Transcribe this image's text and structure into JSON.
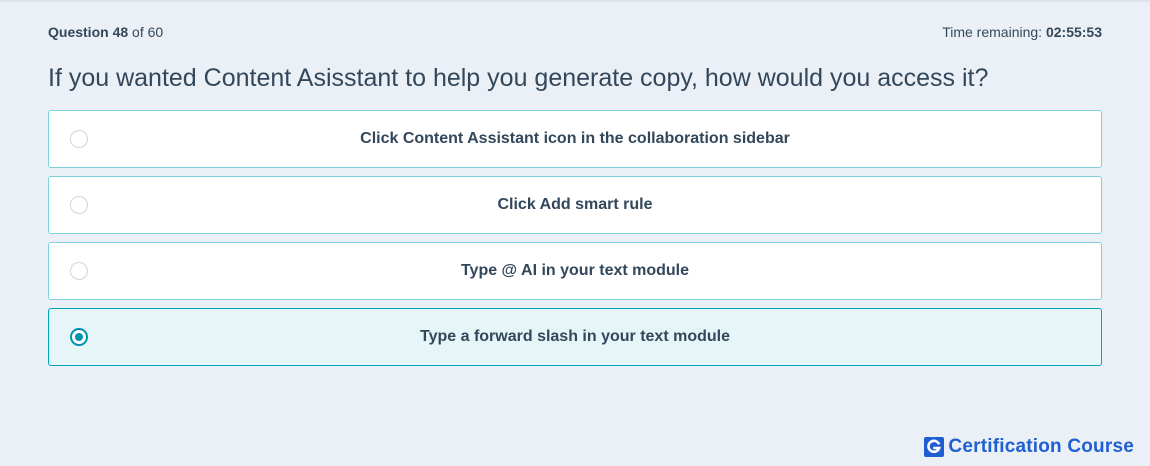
{
  "header": {
    "question_label": "Question",
    "question_number": "48",
    "question_of": "of",
    "question_total": "60",
    "time_label": "Time remaining:",
    "time_value": "02:55:53"
  },
  "question": {
    "text": "If you wanted Content Asisstant to help you generate copy, how would you access it?"
  },
  "options": [
    {
      "label": "Click Content Assistant icon in the collaboration sidebar",
      "selected": false
    },
    {
      "label": "Click Add smart rule",
      "selected": false
    },
    {
      "label": "Type @ AI in your text module",
      "selected": false
    },
    {
      "label": "Type a forward slash in your text module",
      "selected": true
    }
  ],
  "brand": {
    "name": "Certification Course",
    "icon": "g-logo-icon",
    "color": "#1f5fd1"
  },
  "colors": {
    "background": "#eaf0f6",
    "option_border": "#7fd1de",
    "selected_background": "#e5f5f8",
    "selected_accent": "#0091ae",
    "text": "#33475b"
  }
}
